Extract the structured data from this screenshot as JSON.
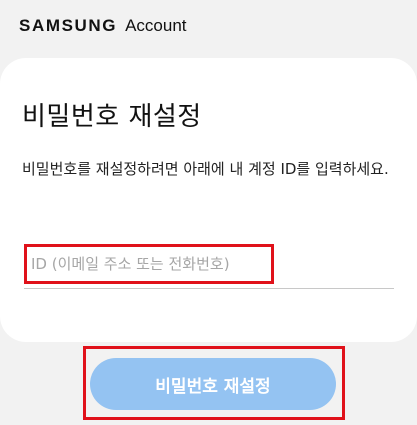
{
  "header": {
    "brand": "SAMSUNG",
    "product": "Account"
  },
  "main": {
    "title": "비밀번호 재설정",
    "description": "비밀번호를 재설정하려면 아래에 내 계정 ID를 입력하세요.",
    "id_field": {
      "value": "",
      "placeholder": "ID (이메일 주소 또는 전화번호)"
    },
    "reset_button": "비밀번호 재설정"
  },
  "colors": {
    "button_disabled": "#94c3f2",
    "highlight": "#e0111a",
    "background": "#f2f2f2"
  }
}
